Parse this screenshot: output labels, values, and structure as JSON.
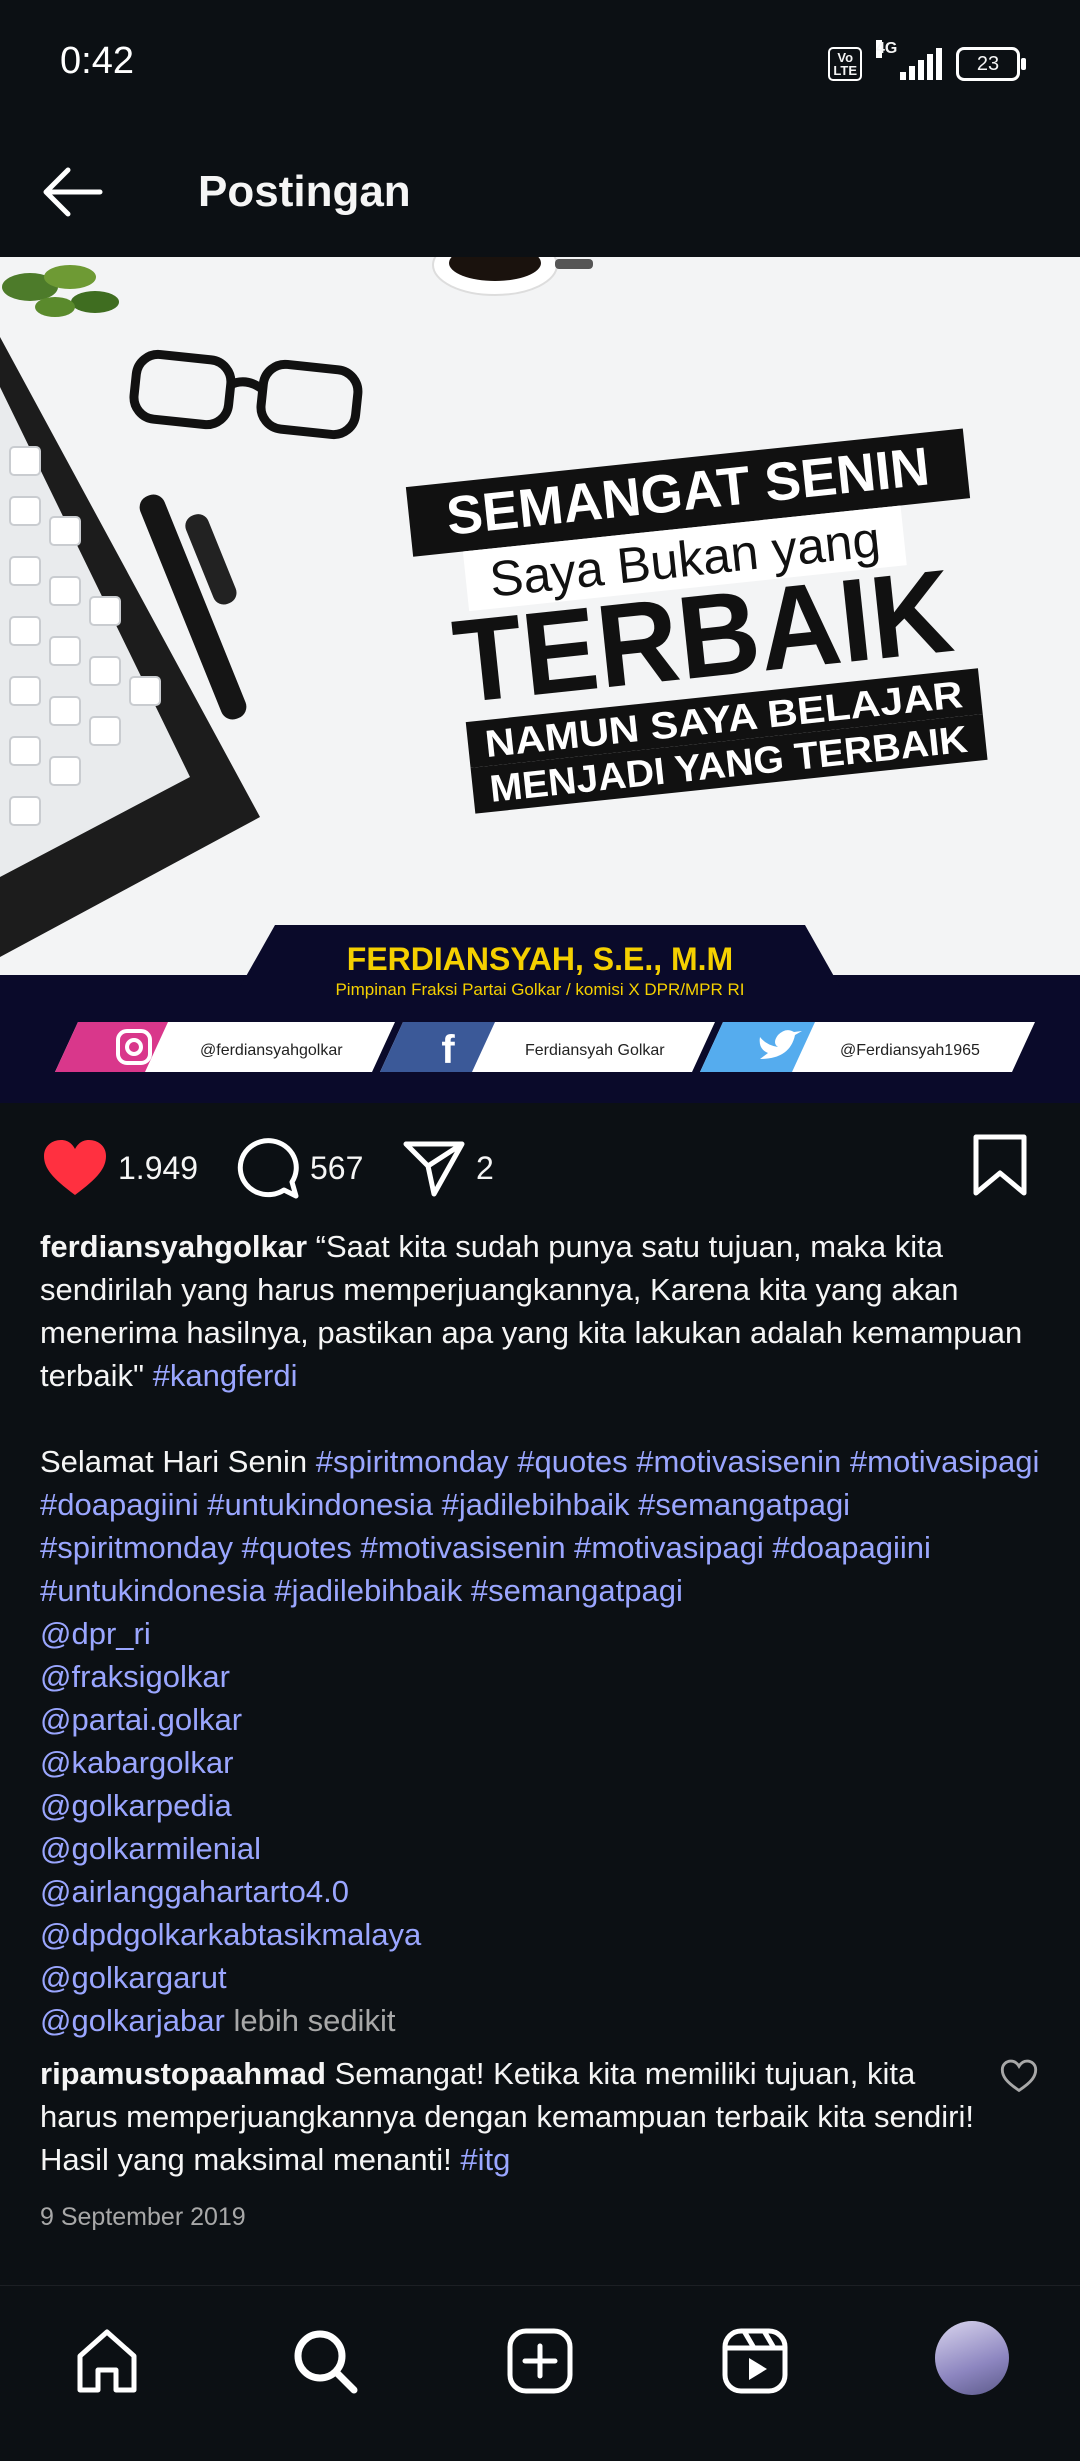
{
  "status_bar": {
    "time": "0:42",
    "volte": "Vo\nLTE",
    "network": "4G",
    "battery": "23"
  },
  "header": {
    "title": "Postingan"
  },
  "post_image": {
    "line1": "SEMANGAT SENIN",
    "line2": "Saya Bukan yang",
    "line3": "TERBAIK",
    "line4": "NAMUN SAYA BELAJAR",
    "line5": "MENJADI YANG TERBAIK",
    "name": "FERDIANSYAH, S.E., M.M",
    "role": "Pimpinan Fraksi Partai Golkar / komisi X DPR/MPR RI",
    "instagram": "@ferdiansyahgolkar",
    "facebook": "Ferdiansyah Golkar",
    "twitter": "@Ferdiansyah1965"
  },
  "actions": {
    "likes": "1.949",
    "comments": "567",
    "shares": "2"
  },
  "caption": {
    "username": "ferdiansyahgolkar",
    "text": "“Saat kita sudah punya satu tujuan, maka kita sendirilah yang harus memperjuangkannya, Karena kita yang akan menerima hasilnya, pastikan apa yang kita lakukan adalah kemampuan terbaik\"",
    "tag1": "#kangferdi",
    "greeting": "Selamat Hari Senin",
    "hashtags": "#spiritmonday #quotes #motivasisenin #motivasipagi #doapagiini #untukindonesia #jadilebihbaik #semangatpagi #spiritmonday #quotes #motivasisenin #motivasipagi #doapagiini #untukindonesia #jadilebihbaik #semangatpagi",
    "mentions": [
      "@dpr_ri",
      "@fraksigolkar",
      "@partai.golkar",
      "@kabargolkar",
      "@golkarpedia",
      "@golkarmilenial",
      "@airlanggahartarto4.0",
      "@dpdgolkarkabtasikmalaya",
      "@golkargarut",
      "@golkarjabar"
    ],
    "more": "lebih sedikit"
  },
  "comment": {
    "username": "ripamustopaahmad",
    "text": "Semangat! Ketika kita memiliki tujuan, kita harus memperjuangkannya dengan kemampuan terbaik kita sendiri! Hasil yang maksimal menanti!",
    "tag": "#itg"
  },
  "post_date": "9 September 2019",
  "colors": {
    "background": "#0c1014",
    "link": "#9aa6ff",
    "like": "#ff3040",
    "muted": "#a8a8a8"
  },
  "nav_icons": [
    "home-icon",
    "search-icon",
    "add-post-icon",
    "reels-icon",
    "profile-avatar"
  ]
}
